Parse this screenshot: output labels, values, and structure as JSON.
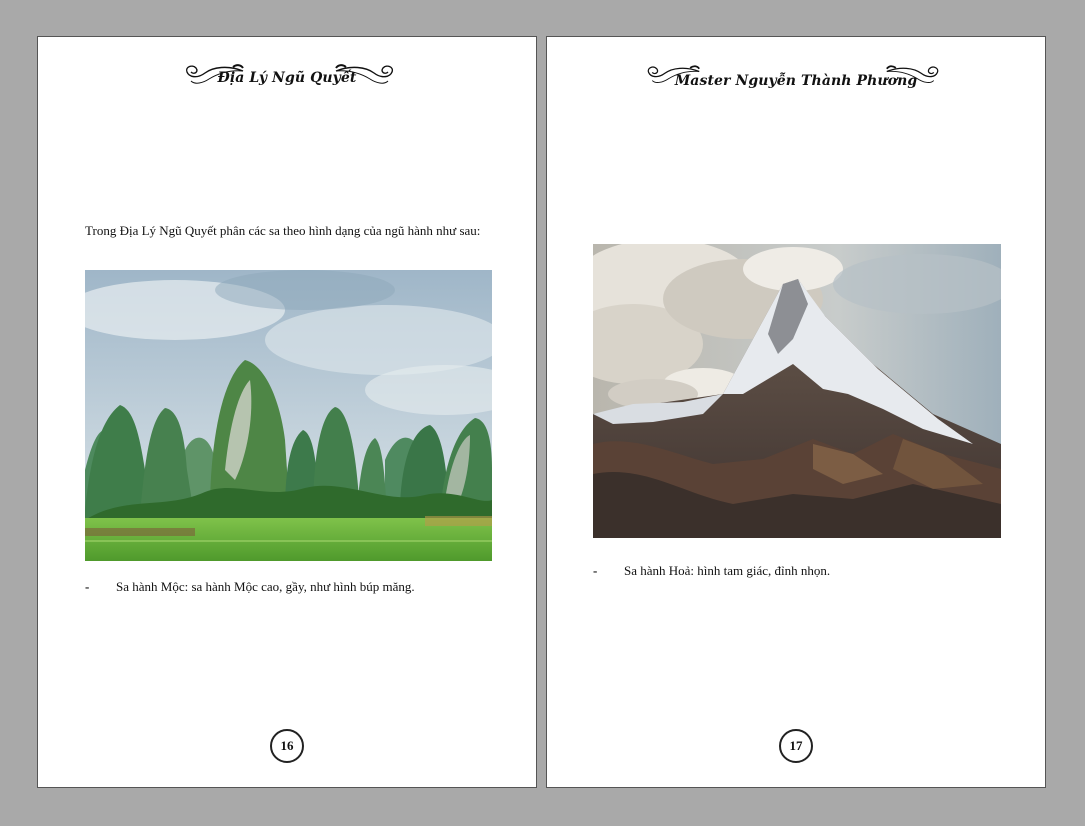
{
  "left_page": {
    "header_title": "Địa Lý Ngũ Quyết",
    "intro": "Trong Địa Lý Ngũ Quyết phân các sa theo hình dạng của ngũ hành như sau:",
    "bullet": "-",
    "caption": "Sa hành Mộc: sa hành Mộc cao, gầy, như hình búp măng.",
    "page_number": "16"
  },
  "right_page": {
    "header_title": "Master Nguyễn Thành Phương",
    "bullet": "-",
    "caption": "Sa hành Hoả: hình tam giác, đỉnh nhọn.",
    "page_number": "17"
  }
}
